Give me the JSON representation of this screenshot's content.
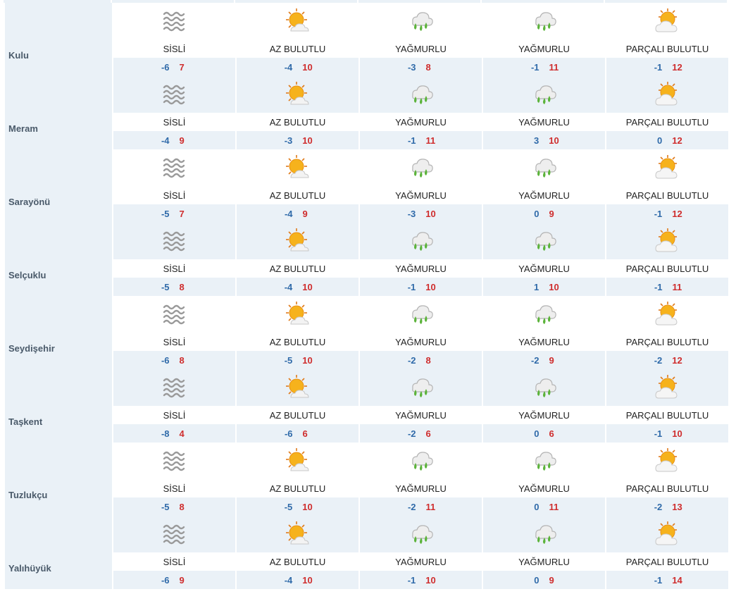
{
  "colors": {
    "row_bg_light": "#ffffff",
    "row_bg_tinted": "#eaf1f7",
    "low_temp": "#2f6aa9",
    "high_temp": "#cf2d2d",
    "city_text": "#4a5a6a"
  },
  "forecast": {
    "rows": [
      {
        "city": "Kulu",
        "days": [
          {
            "icon": "fog-icon",
            "desc": "SİSLİ",
            "low": "-6",
            "high": "7"
          },
          {
            "icon": "mostly-sunny-icon",
            "desc": "AZ BULUTLU",
            "low": "-4",
            "high": "10"
          },
          {
            "icon": "rain-icon",
            "desc": "YAĞMURLU",
            "low": "-3",
            "high": "8"
          },
          {
            "icon": "rain-icon",
            "desc": "YAĞMURLU",
            "low": "-1",
            "high": "11"
          },
          {
            "icon": "partly-cloudy-icon",
            "desc": "PARÇALI BULUTLU",
            "low": "-1",
            "high": "12"
          }
        ]
      },
      {
        "city": "Meram",
        "days": [
          {
            "icon": "fog-icon",
            "desc": "SİSLİ",
            "low": "-4",
            "high": "9"
          },
          {
            "icon": "mostly-sunny-icon",
            "desc": "AZ BULUTLU",
            "low": "-3",
            "high": "10"
          },
          {
            "icon": "rain-icon",
            "desc": "YAĞMURLU",
            "low": "-1",
            "high": "11"
          },
          {
            "icon": "rain-icon",
            "desc": "YAĞMURLU",
            "low": "3",
            "high": "10"
          },
          {
            "icon": "partly-cloudy-icon",
            "desc": "PARÇALI BULUTLU",
            "low": "0",
            "high": "12"
          }
        ]
      },
      {
        "city": "Sarayönü",
        "days": [
          {
            "icon": "fog-icon",
            "desc": "SİSLİ",
            "low": "-5",
            "high": "7"
          },
          {
            "icon": "mostly-sunny-icon",
            "desc": "AZ BULUTLU",
            "low": "-4",
            "high": "9"
          },
          {
            "icon": "rain-icon",
            "desc": "YAĞMURLU",
            "low": "-3",
            "high": "10"
          },
          {
            "icon": "rain-icon",
            "desc": "YAĞMURLU",
            "low": "0",
            "high": "9"
          },
          {
            "icon": "partly-cloudy-icon",
            "desc": "PARÇALI BULUTLU",
            "low": "-1",
            "high": "12"
          }
        ]
      },
      {
        "city": "Selçuklu",
        "days": [
          {
            "icon": "fog-icon",
            "desc": "SİSLİ",
            "low": "-5",
            "high": "8"
          },
          {
            "icon": "mostly-sunny-icon",
            "desc": "AZ BULUTLU",
            "low": "-4",
            "high": "10"
          },
          {
            "icon": "rain-icon",
            "desc": "YAĞMURLU",
            "low": "-1",
            "high": "10"
          },
          {
            "icon": "rain-icon",
            "desc": "YAĞMURLU",
            "low": "1",
            "high": "10"
          },
          {
            "icon": "partly-cloudy-icon",
            "desc": "PARÇALI BULUTLU",
            "low": "-1",
            "high": "11"
          }
        ]
      },
      {
        "city": "Seydişehir",
        "days": [
          {
            "icon": "fog-icon",
            "desc": "SİSLİ",
            "low": "-6",
            "high": "8"
          },
          {
            "icon": "mostly-sunny-icon",
            "desc": "AZ BULUTLU",
            "low": "-5",
            "high": "10"
          },
          {
            "icon": "rain-icon",
            "desc": "YAĞMURLU",
            "low": "-2",
            "high": "8"
          },
          {
            "icon": "rain-icon",
            "desc": "YAĞMURLU",
            "low": "-2",
            "high": "9"
          },
          {
            "icon": "partly-cloudy-icon",
            "desc": "PARÇALI BULUTLU",
            "low": "-2",
            "high": "12"
          }
        ]
      },
      {
        "city": "Taşkent",
        "days": [
          {
            "icon": "fog-icon",
            "desc": "SİSLİ",
            "low": "-8",
            "high": "4"
          },
          {
            "icon": "mostly-sunny-icon",
            "desc": "AZ BULUTLU",
            "low": "-6",
            "high": "6"
          },
          {
            "icon": "rain-icon",
            "desc": "YAĞMURLU",
            "low": "-2",
            "high": "6"
          },
          {
            "icon": "rain-icon",
            "desc": "YAĞMURLU",
            "low": "0",
            "high": "6"
          },
          {
            "icon": "partly-cloudy-icon",
            "desc": "PARÇALI BULUTLU",
            "low": "-1",
            "high": "10"
          }
        ]
      },
      {
        "city": "Tuzlukçu",
        "days": [
          {
            "icon": "fog-icon",
            "desc": "SİSLİ",
            "low": "-5",
            "high": "8"
          },
          {
            "icon": "mostly-sunny-icon",
            "desc": "AZ BULUTLU",
            "low": "-5",
            "high": "10"
          },
          {
            "icon": "rain-icon",
            "desc": "YAĞMURLU",
            "low": "-2",
            "high": "11"
          },
          {
            "icon": "rain-icon",
            "desc": "YAĞMURLU",
            "low": "0",
            "high": "11"
          },
          {
            "icon": "partly-cloudy-icon",
            "desc": "PARÇALI BULUTLU",
            "low": "-2",
            "high": "13"
          }
        ]
      },
      {
        "city": "Yalıhüyük",
        "days": [
          {
            "icon": "fog-icon",
            "desc": "SİSLİ",
            "low": "-6",
            "high": "9"
          },
          {
            "icon": "mostly-sunny-icon",
            "desc": "AZ BULUTLU",
            "low": "-4",
            "high": "10"
          },
          {
            "icon": "rain-icon",
            "desc": "YAĞMURLU",
            "low": "-1",
            "high": "10"
          },
          {
            "icon": "rain-icon",
            "desc": "YAĞMURLU",
            "low": "0",
            "high": "9"
          },
          {
            "icon": "partly-cloudy-icon",
            "desc": "PARÇALI BULUTLU",
            "low": "-1",
            "high": "14"
          }
        ]
      }
    ]
  }
}
